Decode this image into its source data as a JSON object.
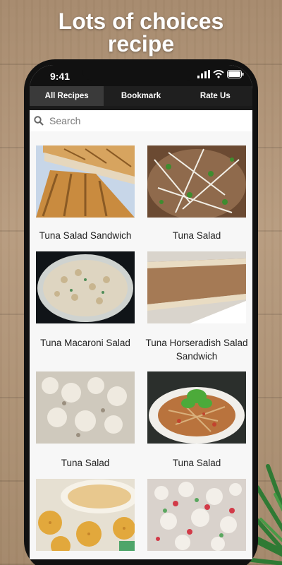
{
  "promo": {
    "line1": "Lots of choices",
    "line2": "recipe"
  },
  "status_bar": {
    "time": "9:41",
    "icons": [
      "signal-icon",
      "wifi-icon",
      "battery-icon"
    ]
  },
  "tabs": [
    {
      "label": "All Recipes",
      "active": true
    },
    {
      "label": "Bookmark",
      "active": false
    },
    {
      "label": "Rate Us",
      "active": false
    }
  ],
  "search": {
    "placeholder": "Search"
  },
  "recipes": [
    {
      "title": "Tuna Salad Sandwich"
    },
    {
      "title": "Tuna Salad"
    },
    {
      "title": "Tuna Macaroni Salad"
    },
    {
      "title": "Tuna Horseradish Salad Sandwich"
    },
    {
      "title": "Tuna Salad"
    },
    {
      "title": "Tuna Salad"
    },
    {
      "title": ""
    },
    {
      "title": ""
    }
  ]
}
